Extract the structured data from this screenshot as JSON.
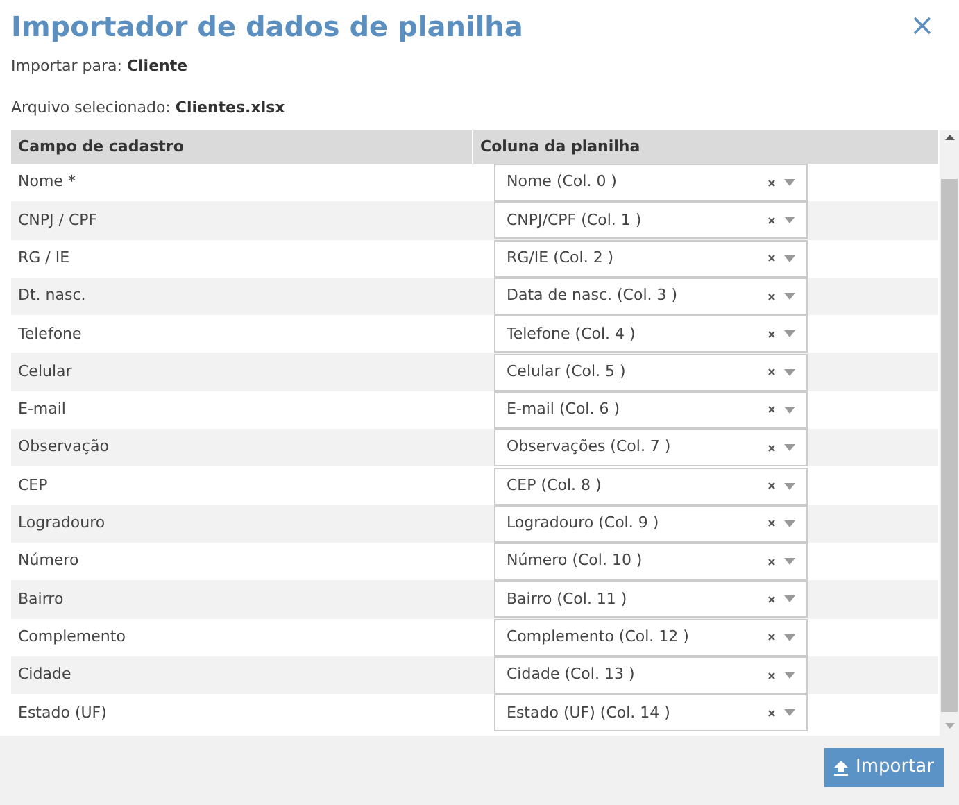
{
  "dialog": {
    "title": "Importador de dados de planilha"
  },
  "import_to": {
    "label": "Importar para:",
    "value": "Cliente"
  },
  "selected_file": {
    "label": "Arquivo selecionado:",
    "value": "Clientes.xlsx"
  },
  "table": {
    "columns": [
      "Campo de cadastro",
      "Coluna da planilha"
    ],
    "rows": [
      {
        "field": "Nome *",
        "column": "Nome (Col. 0 )"
      },
      {
        "field": "CNPJ / CPF",
        "column": "CNPJ/CPF (Col. 1 )"
      },
      {
        "field": "RG / IE",
        "column": "RG/IE (Col. 2 )"
      },
      {
        "field": "Dt. nasc.",
        "column": "Data de nasc. (Col. 3 )"
      },
      {
        "field": "Telefone",
        "column": "Telefone (Col. 4 )"
      },
      {
        "field": "Celular",
        "column": "Celular (Col. 5 )"
      },
      {
        "field": "E-mail",
        "column": "E-mail (Col. 6 )"
      },
      {
        "field": "Observação",
        "column": "Observações (Col. 7 )"
      },
      {
        "field": "CEP",
        "column": "CEP (Col. 8 )"
      },
      {
        "field": "Logradouro",
        "column": "Logradouro (Col. 9 )"
      },
      {
        "field": "Número",
        "column": "Número (Col. 10 )"
      },
      {
        "field": "Bairro",
        "column": "Bairro (Col. 11 )"
      },
      {
        "field": "Complemento",
        "column": "Complemento (Col. 12 )"
      },
      {
        "field": "Cidade",
        "column": "Cidade (Col. 13 )"
      },
      {
        "field": "Estado (UF)",
        "column": "Estado (UF) (Col. 14 )"
      }
    ]
  },
  "footer": {
    "button": "Importar"
  }
}
